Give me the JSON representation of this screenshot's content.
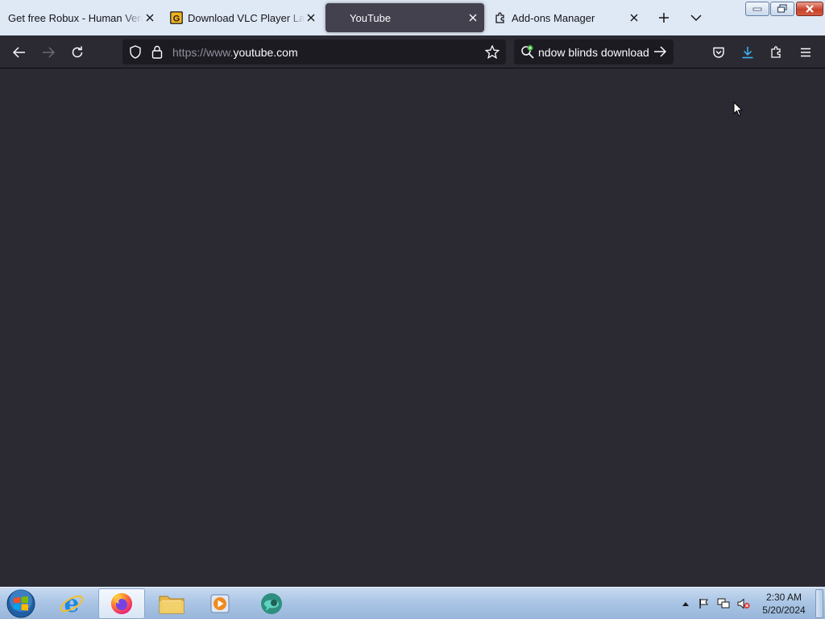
{
  "browser": {
    "tabs": [
      {
        "label": "Get free Robux - Human Verification",
        "active": false
      },
      {
        "label": "Download VLC Player Latest",
        "active": false
      },
      {
        "label": "YouTube",
        "active": true
      },
      {
        "label": "Add-ons Manager",
        "active": false
      }
    ],
    "url": {
      "prefix": "https://www.",
      "domain": "youtube.com"
    },
    "search": {
      "value": "ndow blinds download"
    }
  },
  "taskbar": {
    "clock_time": "2:30 AM",
    "clock_date": "5/20/2024"
  },
  "colors": {
    "content_bg": "#2b2a33",
    "tabstrip_bg": "#dfe9f5",
    "accent_download": "#3fb6f7"
  }
}
